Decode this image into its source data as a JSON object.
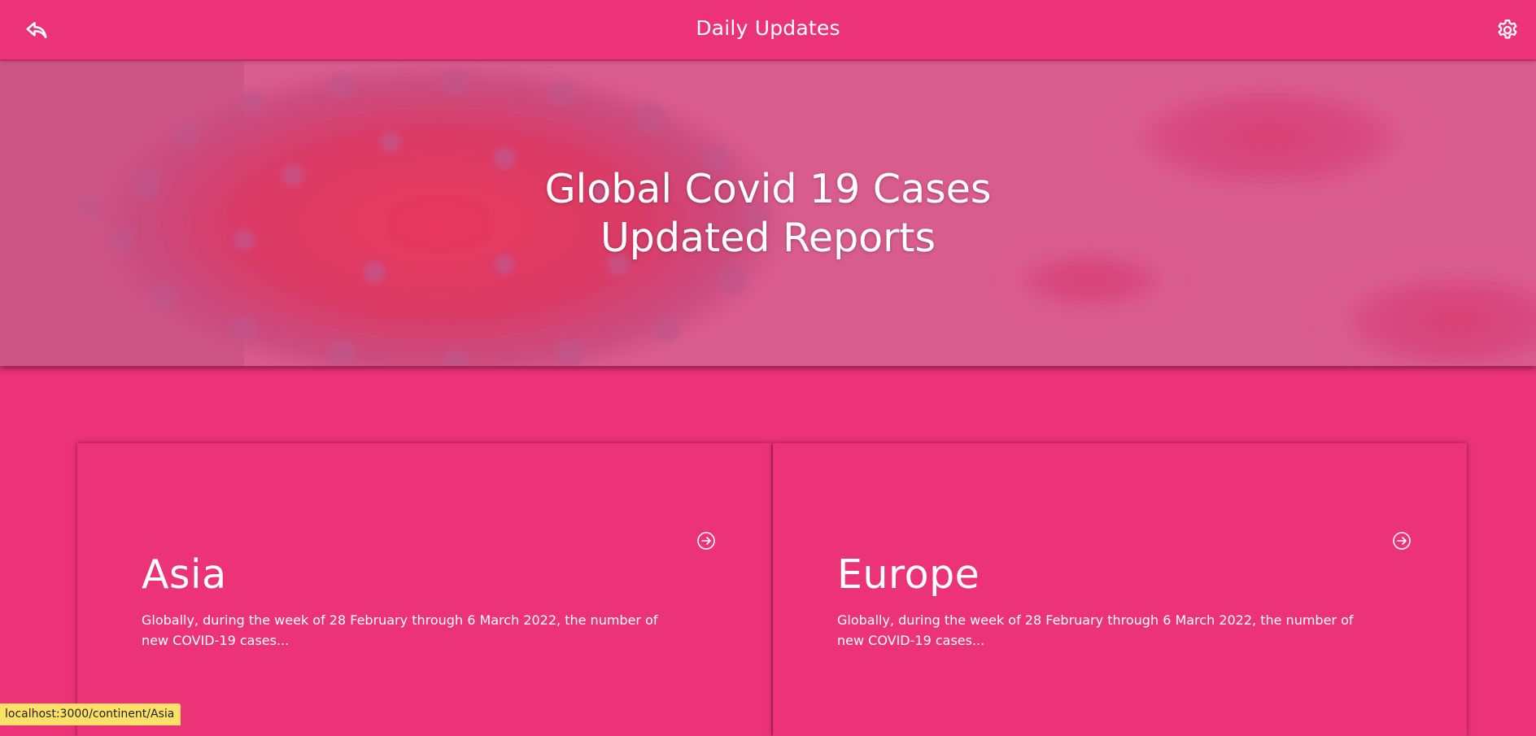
{
  "header": {
    "title": "Daily Updates",
    "back_icon": "back-reply-icon",
    "settings_icon": "gear-icon"
  },
  "hero": {
    "line1": "Global Covid 19 Cases",
    "line2": "Updated Reports"
  },
  "cards": [
    {
      "name": "Asia",
      "description": "Globally, during the week of 28 February through 6 March 2022, the number of new COVID-19 cases...",
      "icon": "arrow-circle-right-icon"
    },
    {
      "name": "Europe",
      "description": "Globally, during the week of 28 February through 6 March 2022, the number of new COVID-19 cases...",
      "icon": "arrow-circle-right-icon"
    }
  ],
  "status_url": "localhost:3000/continent/Asia",
  "colors": {
    "primary": "#ec3377",
    "status_bg": "#fce068"
  }
}
